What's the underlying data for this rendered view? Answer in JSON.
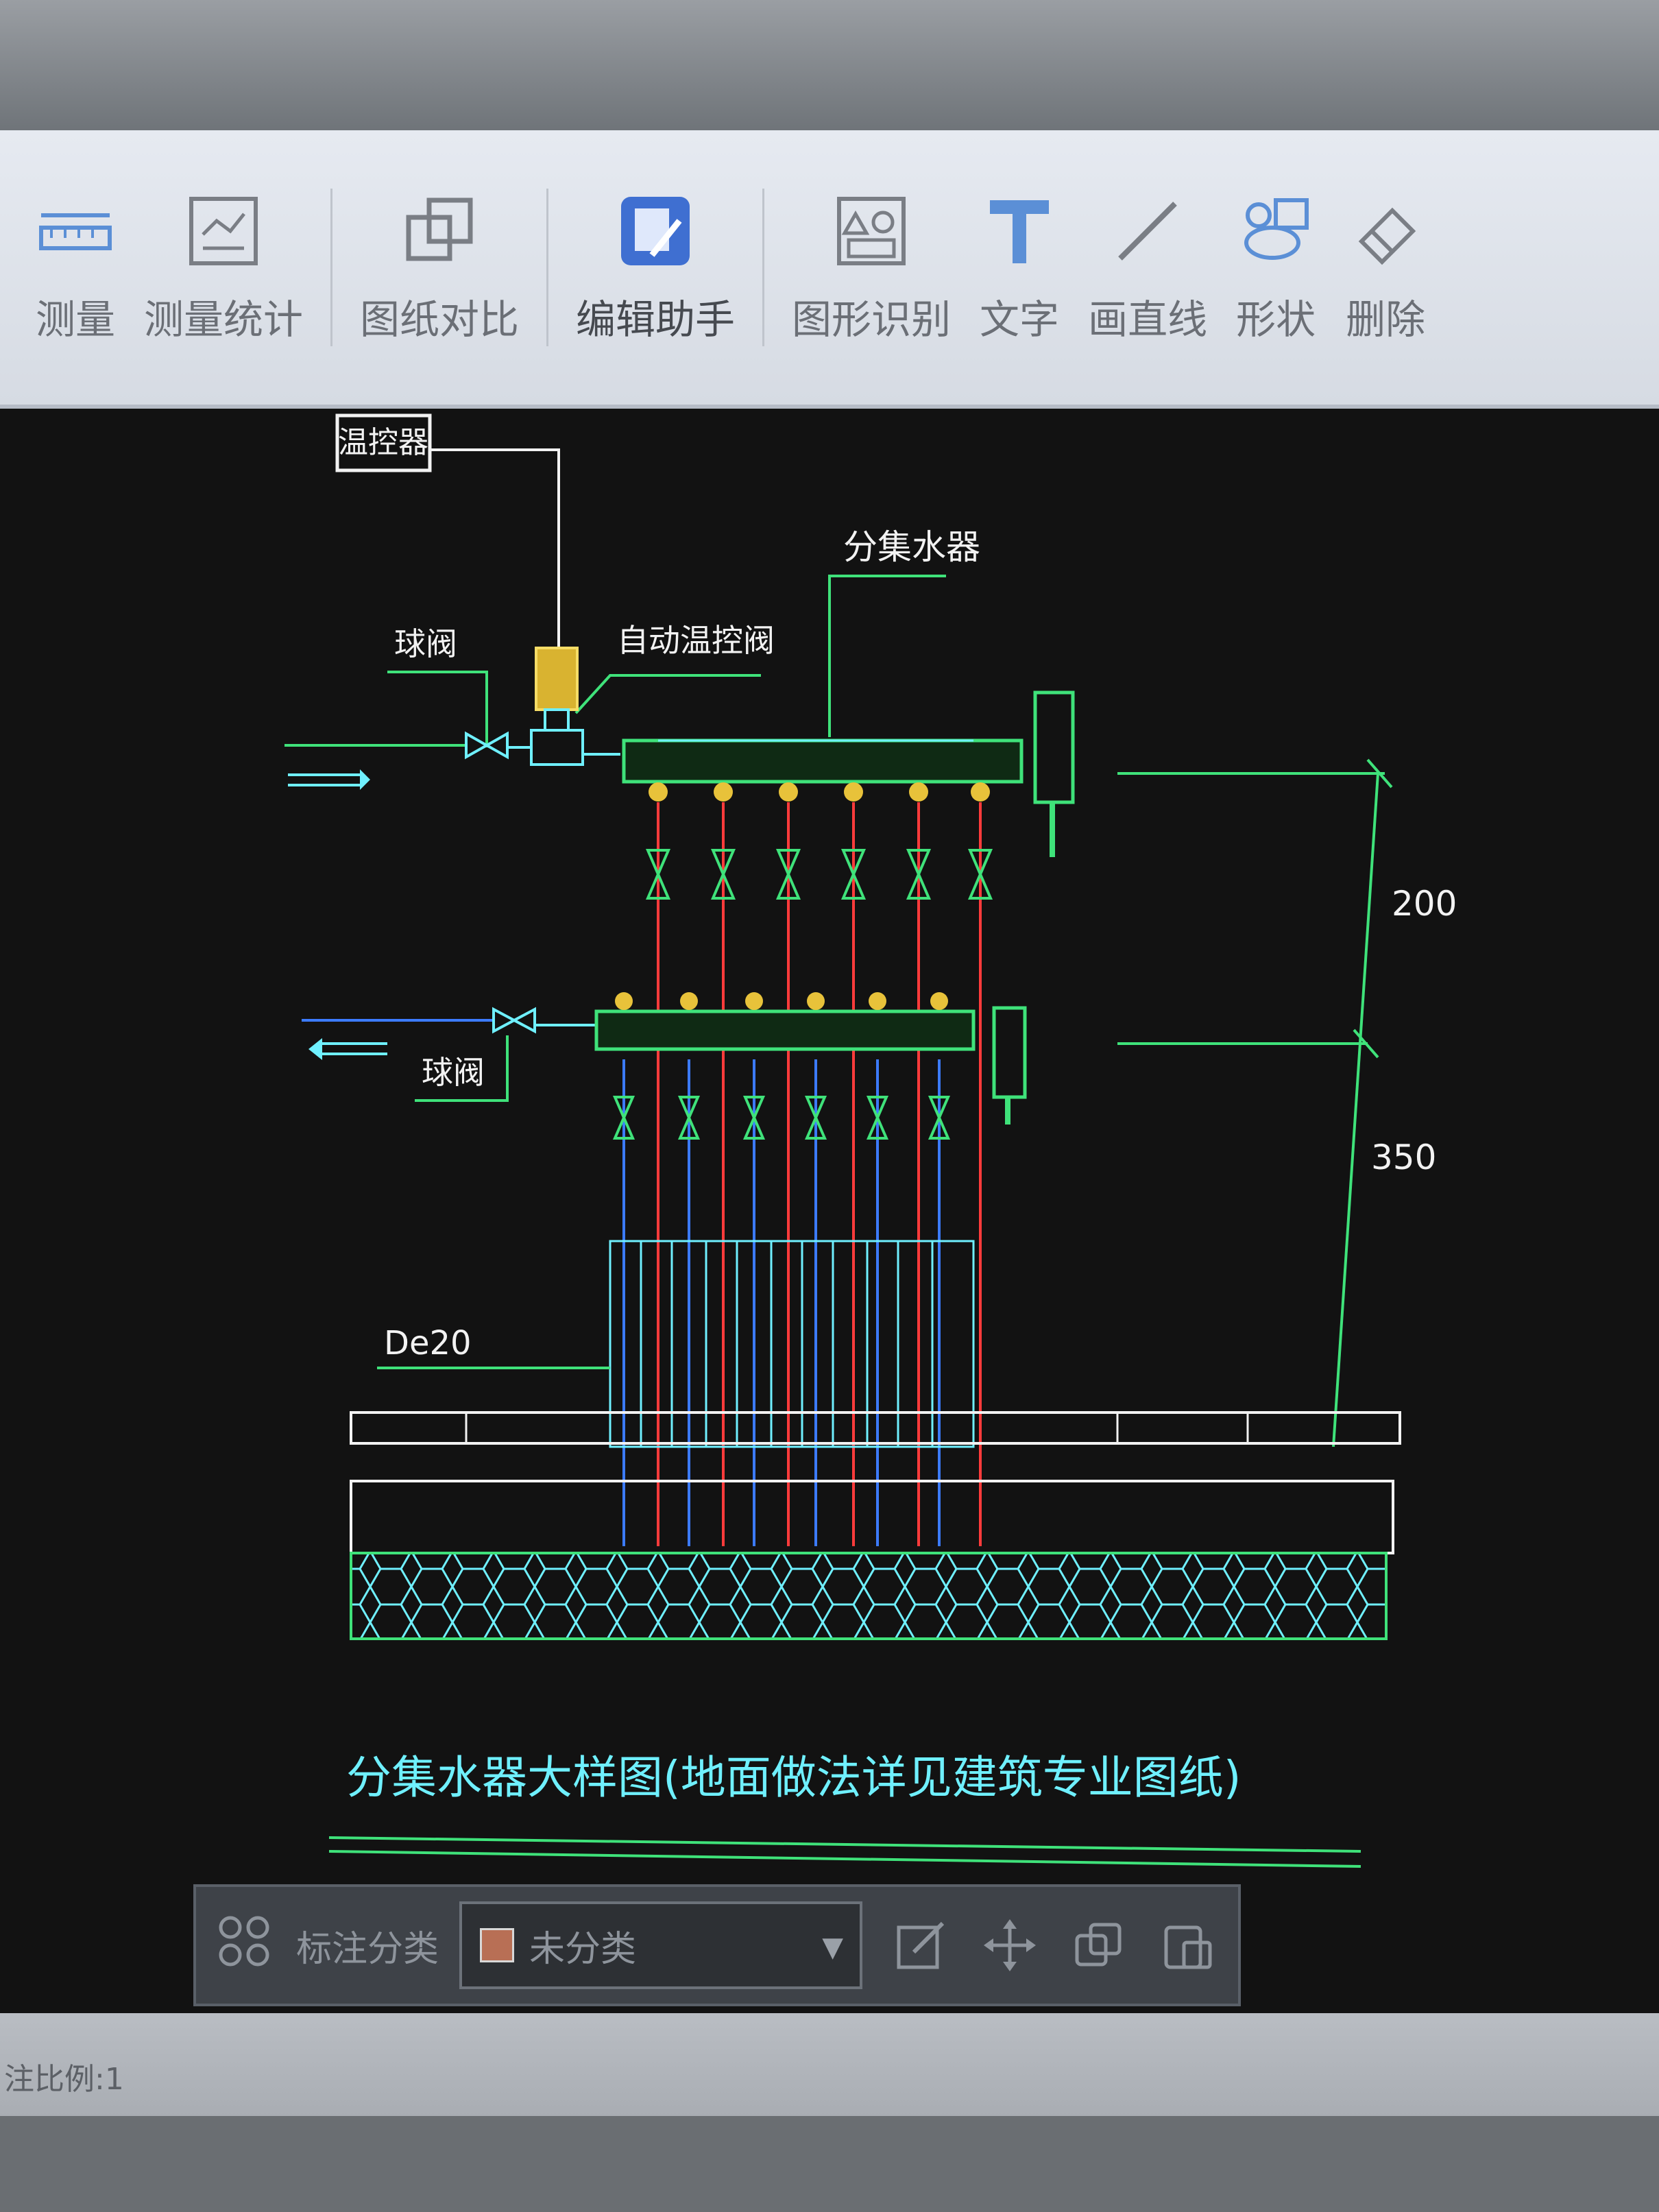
{
  "toolbar": {
    "items": [
      {
        "label": "测量",
        "icon": "measure-ruler-icon"
      },
      {
        "label": "测量统计",
        "icon": "measure-stats-icon"
      },
      {
        "label": "图纸对比",
        "icon": "compare-drawings-icon"
      },
      {
        "label": "编辑助手",
        "icon": "cad-edit-assistant-icon"
      },
      {
        "label": "图形识别",
        "icon": "shape-recognition-icon"
      },
      {
        "label": "文字",
        "icon": "text-icon"
      },
      {
        "label": "画直线",
        "icon": "draw-line-icon"
      },
      {
        "label": "形状",
        "icon": "shape-icon"
      },
      {
        "label": "删除",
        "icon": "eraser-icon"
      }
    ]
  },
  "drawing": {
    "thermostat_label": "温控器",
    "ball_valve_top": "球阀",
    "auto_valve": "自动温控阀",
    "manifold_label": "分集水器",
    "ball_valve_bottom": "球阀",
    "dim_200": "200",
    "dim_350": "350",
    "pipe_size": "De20",
    "title": "分集水器大样图(地面做法详见建筑专业图纸)",
    "colors": {
      "green": "#3fe27a",
      "cyan": "#6ff0ff",
      "red": "#ff3b3b",
      "blue": "#3c7bff",
      "yellow": "#e8c23a",
      "white": "#f2f2f2"
    }
  },
  "annotation_bar": {
    "label": "标注分类",
    "selected": "未分类",
    "swatch_color": "#b86f55"
  },
  "status": {
    "scale_text": "注比例:1"
  }
}
